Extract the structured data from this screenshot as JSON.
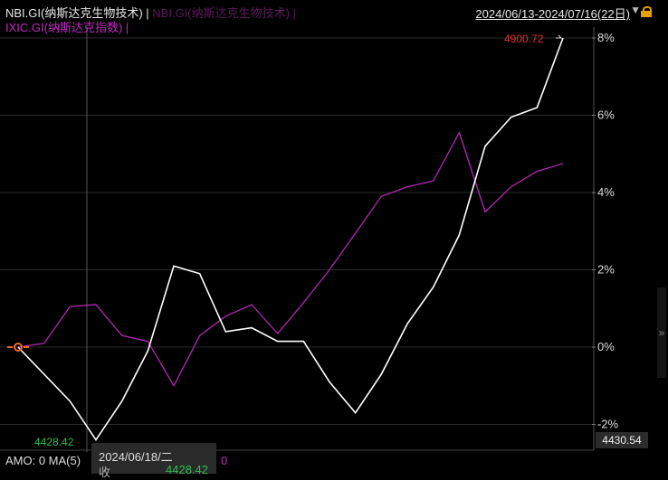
{
  "header": {
    "main_series": "NBI.GI(纳斯达克生物技术) |",
    "ghost_series": "NBI.GI(纳斯达克生物技术) |",
    "compare_series": "IXIC.GI(纳斯达克指数) |",
    "date_range": "2024/06/13-2024/07/16(22日)"
  },
  "colors": {
    "nbi": "#ffffff",
    "ixic": "#b02ab0",
    "grid": "#2a2a2a",
    "max_label": "#e03030",
    "min_label": "#2fbf4f"
  },
  "chart_data": {
    "type": "line",
    "ylim": [
      -2.4,
      8.2
    ],
    "y_ticks": [
      "8%",
      "6%",
      "4%",
      "2%",
      "0%",
      "-2%"
    ],
    "y_tick_values": [
      8,
      6,
      4,
      2,
      0,
      -2
    ],
    "series": [
      {
        "name": "NBI.GI(纳斯达克生物技术)",
        "values": [
          0,
          -0.7,
          -1.4,
          -2.4,
          -1.4,
          -0.1,
          2.1,
          1.9,
          0.4,
          0.5,
          0.15,
          0.15,
          -0.9,
          -1.7,
          -0.7,
          0.6,
          1.55,
          2.9,
          5.2,
          5.95,
          6.2,
          8.0
        ]
      },
      {
        "name": "IXIC.GI(纳斯达克指数)",
        "values": [
          0,
          0.1,
          1.05,
          1.1,
          0.3,
          0.15,
          -1.0,
          0.3,
          0.8,
          1.1,
          0.35,
          1.15,
          2.0,
          2.95,
          3.9,
          4.15,
          4.3,
          5.55,
          3.5,
          4.15,
          4.55,
          4.75
        ]
      }
    ],
    "max_label": "4900.72",
    "min_label": "4428.42",
    "last_price": "4430.54"
  },
  "footer": {
    "amo": "AMO: 0  MA(5)",
    "amo_value": "0",
    "tooltip_date": "2024/06/18/二",
    "tooltip_row_label": "收",
    "tooltip_value": "4428.42"
  }
}
